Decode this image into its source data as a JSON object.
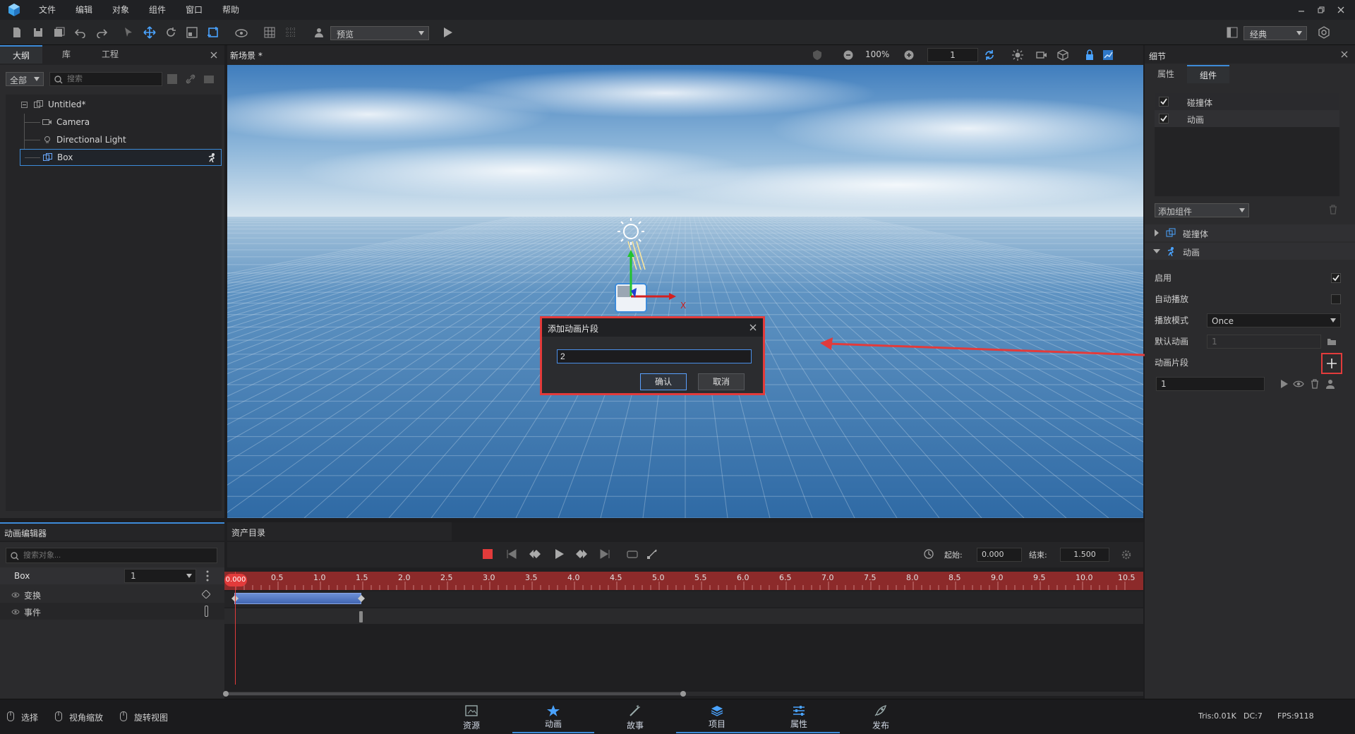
{
  "menubar": {
    "items": [
      "文件",
      "编辑",
      "对象",
      "组件",
      "窗口",
      "帮助"
    ],
    "window_controls": [
      "minimize",
      "restore",
      "close"
    ]
  },
  "toolbar": {
    "preview_select": "预览",
    "layout_select": "经典",
    "icons": [
      "new-file-icon",
      "save-icon",
      "save-all-icon",
      "undo-icon",
      "redo-icon",
      "select-arrow-icon",
      "move-icon",
      "rotate-icon",
      "scale-icon",
      "rect-transform-icon",
      "cloud-icon",
      "grid-icon",
      "snap-grid-icon",
      "avatar-icon",
      "play-icon",
      "layout-icon",
      "settings-icon"
    ]
  },
  "left_panel": {
    "tabs": [
      "大纲",
      "库",
      "工程"
    ],
    "filter_select": "全部",
    "search_placeholder": "搜索",
    "tree": {
      "root": "Untitled*",
      "children": [
        "Camera",
        "Directional Light",
        "Box"
      ],
      "selected": "Box"
    }
  },
  "scene": {
    "tab_title": "新场景 *",
    "zoom": "100%",
    "frame": "1",
    "axis_label": "X"
  },
  "dialog": {
    "title": "添加动画片段",
    "input_value": "2",
    "confirm_label": "确认",
    "cancel_label": "取消"
  },
  "right_panel": {
    "title": "细节",
    "tabs": [
      "属性",
      "组件"
    ],
    "active_tab": "组件",
    "components": [
      {
        "label": "碰撞体",
        "checked": true
      },
      {
        "label": "动画",
        "checked": true
      }
    ],
    "add_component_label": "添加组件",
    "sections": {
      "collider": "碰撞体",
      "animation": "动画"
    },
    "properties": {
      "enable_label": "启用",
      "enable_checked": true,
      "autoplay_label": "自动播放",
      "autoplay_checked": false,
      "play_mode_label": "播放模式",
      "play_mode_value": "Once",
      "default_anim_label": "默认动画",
      "default_anim_value": "1",
      "clips_label": "动画片段",
      "clip_value": "1"
    }
  },
  "anim_editor": {
    "title": "动画编辑器",
    "assets_tab": "资产目录",
    "search_placeholder": "搜索对象...",
    "object_name": "Box",
    "clip_select": "1",
    "tracks": [
      "变换",
      "事件"
    ],
    "start_label": "起始:",
    "start_value": "0.000",
    "end_label": "结束:",
    "end_value": "1.500",
    "playhead_value": "0.000",
    "ticks": [
      "0.5",
      "1.0",
      "1.5",
      "2.0",
      "2.5",
      "3.0",
      "3.5",
      "4.0",
      "4.5",
      "5.0",
      "5.5",
      "6.0",
      "6.5",
      "7.0",
      "7.5",
      "8.0",
      "8.5",
      "9.0",
      "9.5",
      "10.0",
      "10.5"
    ]
  },
  "statusbar": {
    "tools": [
      "选择",
      "视角缩放",
      "旋转视图"
    ],
    "bottom_tabs": [
      "资源",
      "动画",
      "故事",
      "项目",
      "属性",
      "发布"
    ],
    "active_tabs": [
      "动画",
      "项目",
      "属性"
    ],
    "stats": {
      "tris": "Tris:0.01K",
      "dc": "DC:7",
      "fps": "FPS:9118"
    }
  },
  "colors": {
    "accent": "#3d8bd9",
    "highlight_red": "#e23b3b",
    "timeline_red": "#8c2a2a",
    "clip_blue": "#4a6fb8"
  }
}
